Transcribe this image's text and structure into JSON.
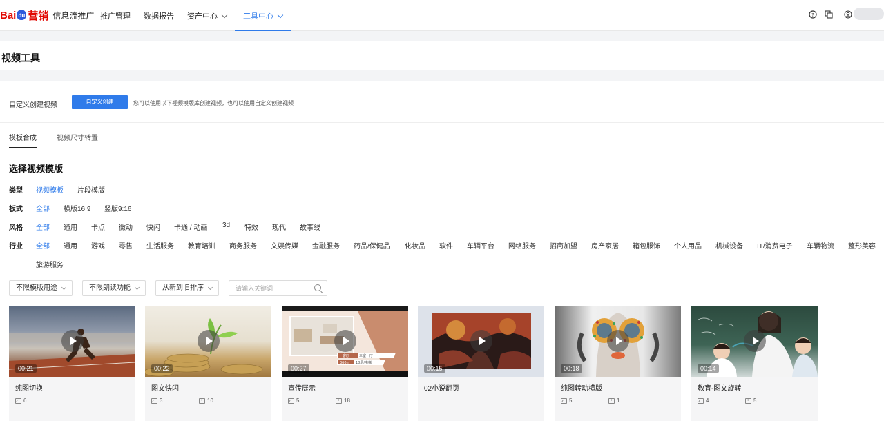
{
  "brand": {
    "part1": "Bai",
    "paw": "du",
    "part2": "营销",
    "product": "信息流推广"
  },
  "nav": {
    "items": [
      {
        "label": "推广管理"
      },
      {
        "label": "数据报告"
      },
      {
        "label": "资产中心"
      },
      {
        "label": "工具中心"
      }
    ]
  },
  "page": {
    "title": "视频工具"
  },
  "custom": {
    "label": "自定义创建视频",
    "button": "自定义创建",
    "hint": "您可以使用以下视频模版库创建视频，也可以使用自定义创建视频"
  },
  "tabs": [
    {
      "label": "模板合成"
    },
    {
      "label": "视频尺寸转置"
    }
  ],
  "section_title": "选择视频模版",
  "filters": {
    "type": {
      "label": "类型",
      "options": [
        "视频模板",
        "片段模版"
      ]
    },
    "format": {
      "label": "板式",
      "options": [
        "全部",
        "横版16:9",
        "竖版9:16"
      ]
    },
    "style": {
      "label": "风格",
      "options": [
        "全部",
        "通用",
        "卡点",
        "微动",
        "快闪",
        "卡通 / 动画",
        "3d",
        "特效",
        "现代",
        "故事线"
      ]
    },
    "industry": {
      "label": "行业",
      "options": [
        "全部",
        "通用",
        "游戏",
        "零售",
        "生活服务",
        "教育培训",
        "商务服务",
        "文娱传媒",
        "金融服务",
        "药品/保健品",
        "化妆品",
        "软件",
        "车辆平台",
        "网络服务",
        "招商加盟",
        "房产家居",
        "箱包服饰",
        "个人用品",
        "机械设备",
        "IT/消费电子",
        "车辆物流",
        "整形美容",
        "旅游服务"
      ]
    }
  },
  "toolbar": {
    "usage": "不限模版用途",
    "reading": "不限朗读功能",
    "sort": "从新到旧排序",
    "search_placeholder": "请输入关键词"
  },
  "templates": [
    {
      "name": "纯图切换",
      "duration": "00:21",
      "images": "6",
      "texts": ""
    },
    {
      "name": "图文快闪",
      "duration": "00:22",
      "images": "3",
      "texts": "10"
    },
    {
      "name": "宣传展示",
      "duration": "00:27",
      "images": "5",
      "texts": "18"
    },
    {
      "name": "02小说翻页",
      "duration": "00:15",
      "images": "",
      "texts": ""
    },
    {
      "name": "纯图转动横版",
      "duration": "00:18",
      "images": "5",
      "texts": "1"
    },
    {
      "name": "教育-图文旋转",
      "duration": "00:14",
      "images": "4",
      "texts": "5"
    }
  ],
  "promo_text": {
    "line1": "客厅",
    "line2": "三室一厅",
    "line3": "360m",
    "line4": "18层/电梯"
  },
  "colors": {
    "accent": "#2f7bea",
    "brand_red": "#e10601"
  }
}
